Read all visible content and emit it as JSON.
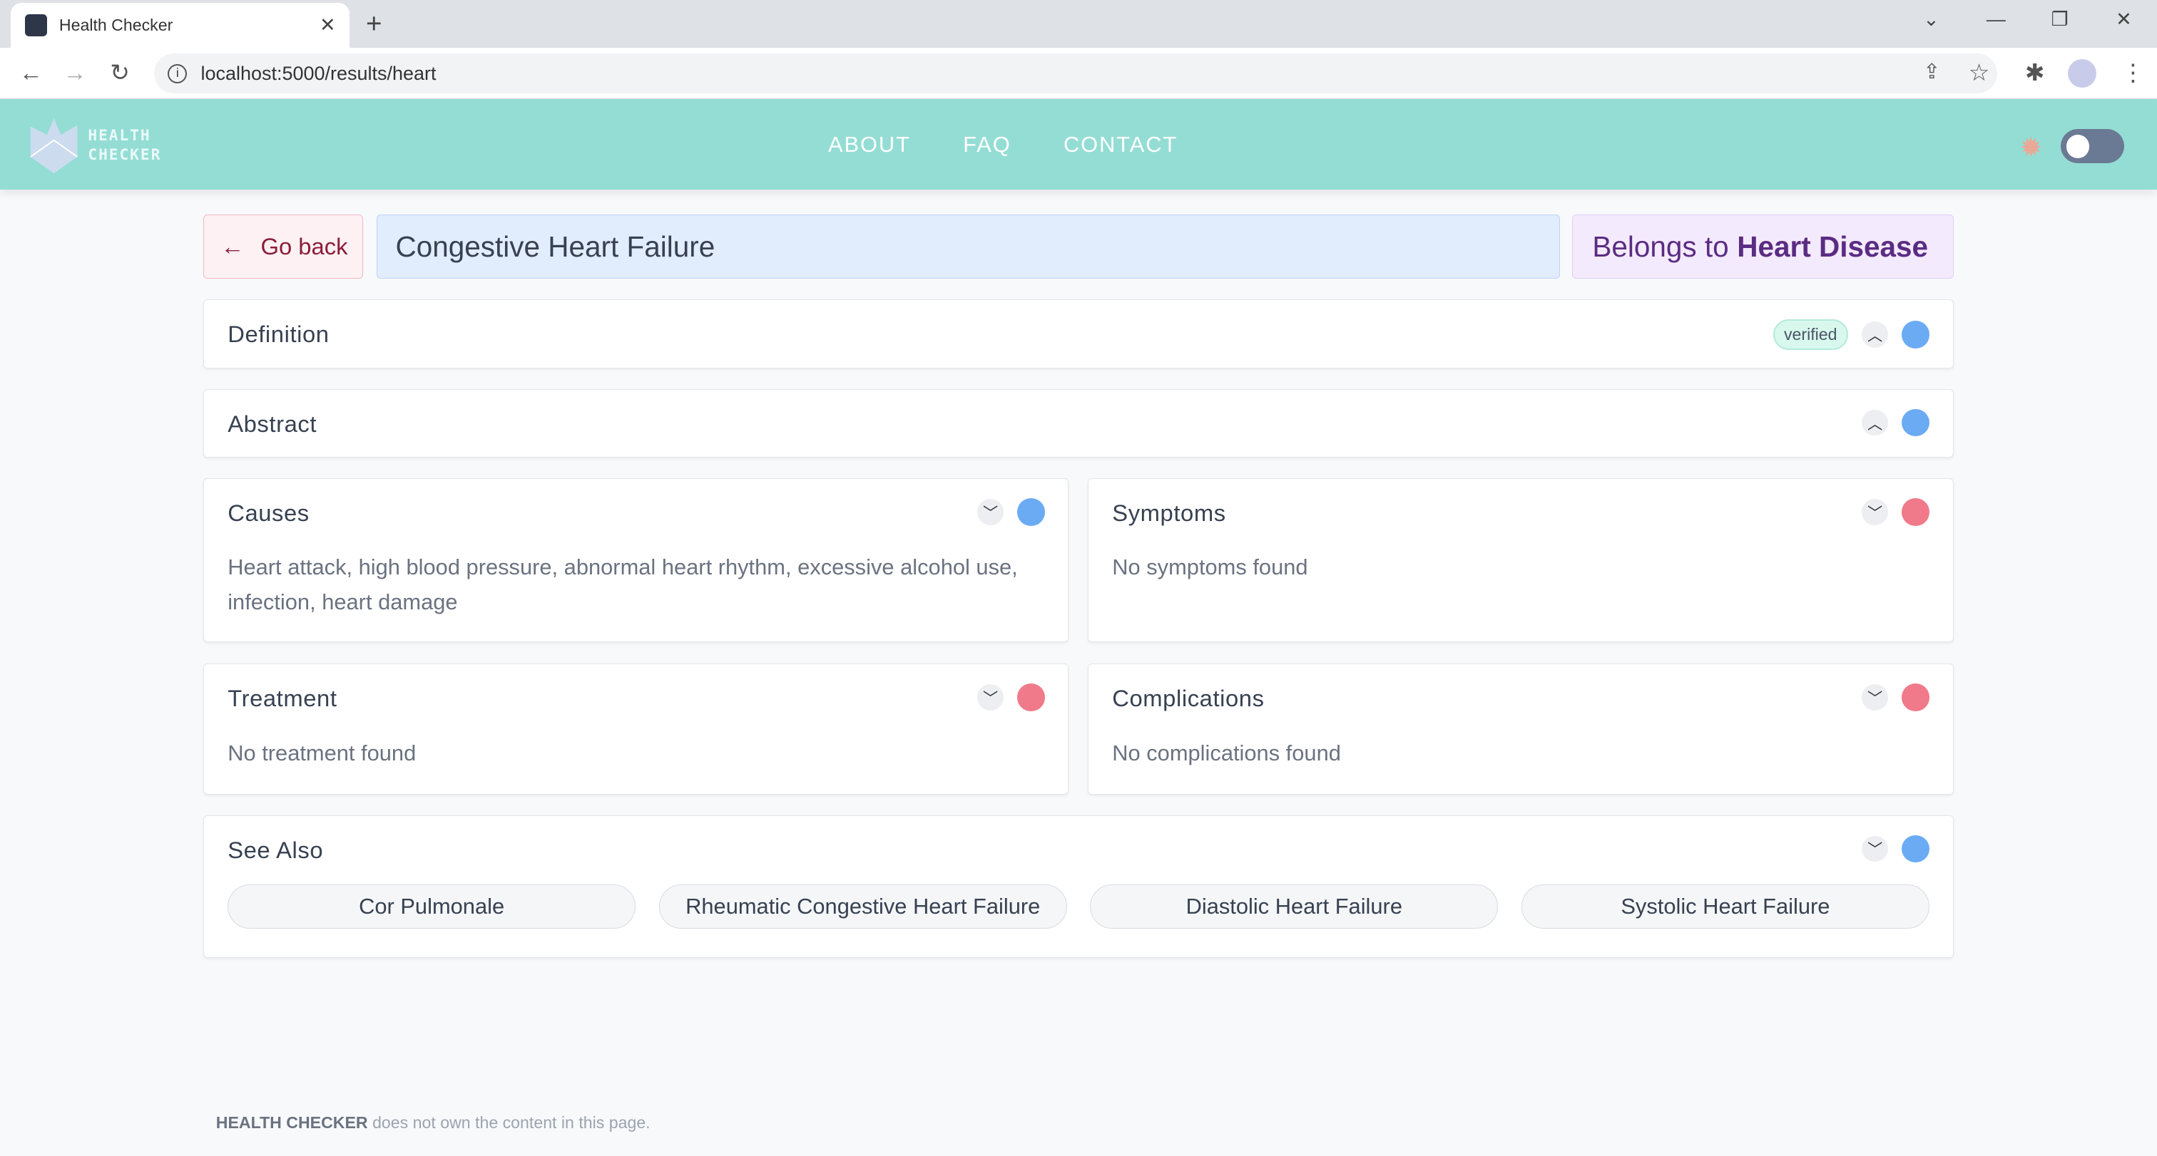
{
  "browser": {
    "tab_title": "Health Checker",
    "url": "localhost:5000/results/heart"
  },
  "header": {
    "logo_line1": "HEALTH",
    "logo_line2": "CHECKER",
    "nav": [
      "ABOUT",
      "FAQ",
      "CONTACT"
    ],
    "theme_toggle_on": false
  },
  "topbar": {
    "go_back": "Go back",
    "title": "Congestive Heart Failure",
    "belongs_prefix": "Belongs to",
    "belongs_category": "Heart Disease"
  },
  "sections": {
    "definition": {
      "title": "Definition",
      "badge": "verified",
      "expanded": true,
      "status": "blue"
    },
    "abstract": {
      "title": "Abstract",
      "expanded": true,
      "status": "blue"
    },
    "causes": {
      "title": "Causes",
      "text": "Heart attack, high blood pressure, abnormal heart rhythm, excessive alcohol use, infection, heart damage",
      "status": "blue"
    },
    "symptoms": {
      "title": "Symptoms",
      "text": "No symptoms found",
      "status": "red"
    },
    "treatment": {
      "title": "Treatment",
      "text": "No treatment found",
      "status": "red"
    },
    "complications": {
      "title": "Complications",
      "text": "No complications found",
      "status": "red"
    },
    "see_also": {
      "title": "See Also",
      "status": "blue",
      "items": [
        "Cor Pulmonale",
        "Rheumatic Congestive Heart Failure",
        "Diastolic Heart Failure",
        "Systolic Heart Failure"
      ]
    }
  },
  "footer": {
    "brand": "HEALTH CHECKER",
    "text": "does not own the content in this page."
  },
  "colors": {
    "header": "#94ddd5",
    "blue": "#6aabf4",
    "red": "#f07a8a",
    "category": "#5b2c83"
  }
}
